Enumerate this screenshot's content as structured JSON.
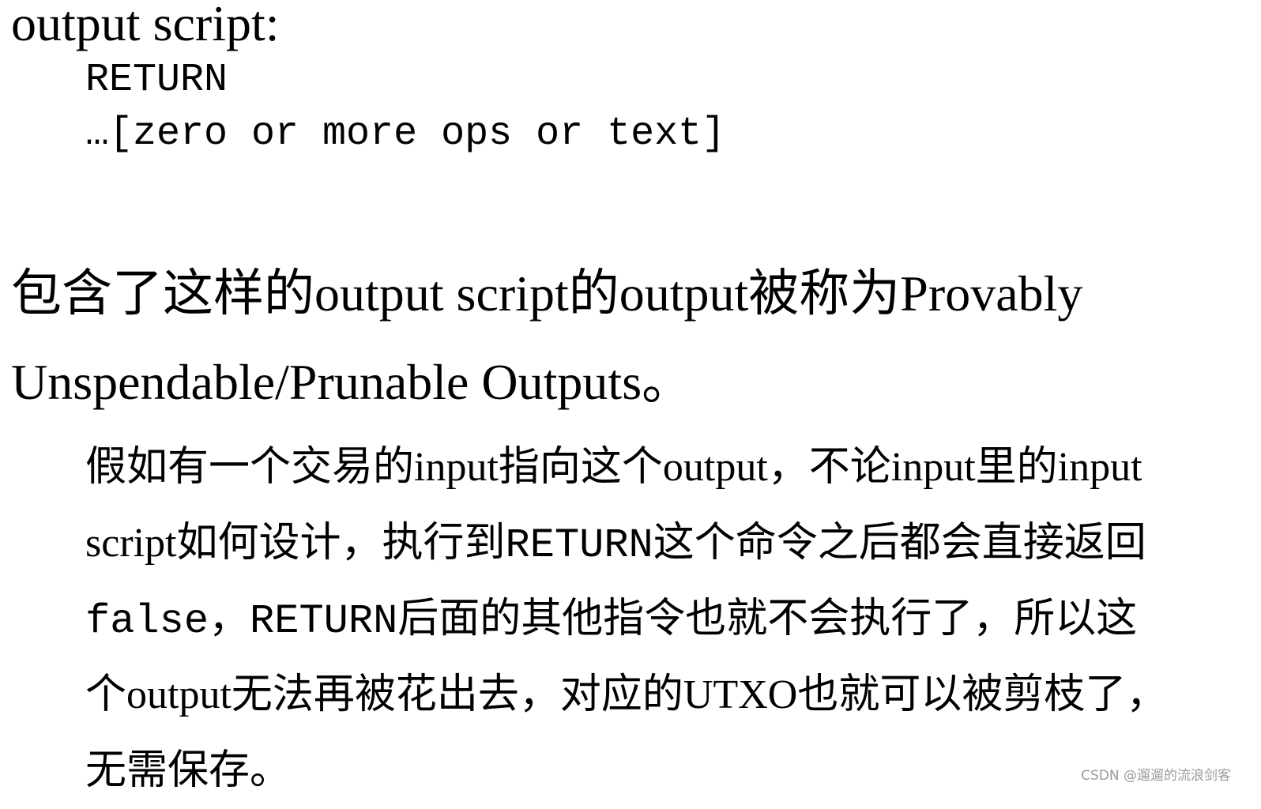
{
  "heading": "output script:",
  "code": {
    "line1": "RETURN",
    "line2": "…[zero or more ops or text]"
  },
  "para1": {
    "line1_a": "包含了这样的output script的output被称为Provably",
    "line2": "Unspendable/Prunable Outputs。"
  },
  "para2": {
    "line1": "假如有一个交易的input指向这个output，不论input里的input",
    "line2_a": "script如何设计，执行到",
    "line2_code": "RETURN",
    "line2_b": "这个命令之后都会直接返回",
    "line3_code1": "false",
    "line3_a": "，",
    "line3_code2": "RETURN",
    "line3_b": "后面的其他指令也就不会执行了，所以这",
    "line4": "个output无法再被花出去，对应的UTXO也就可以被剪枝了，",
    "line5": "无需保存。"
  },
  "watermark": "CSDN @遛遛的流浪剑客"
}
